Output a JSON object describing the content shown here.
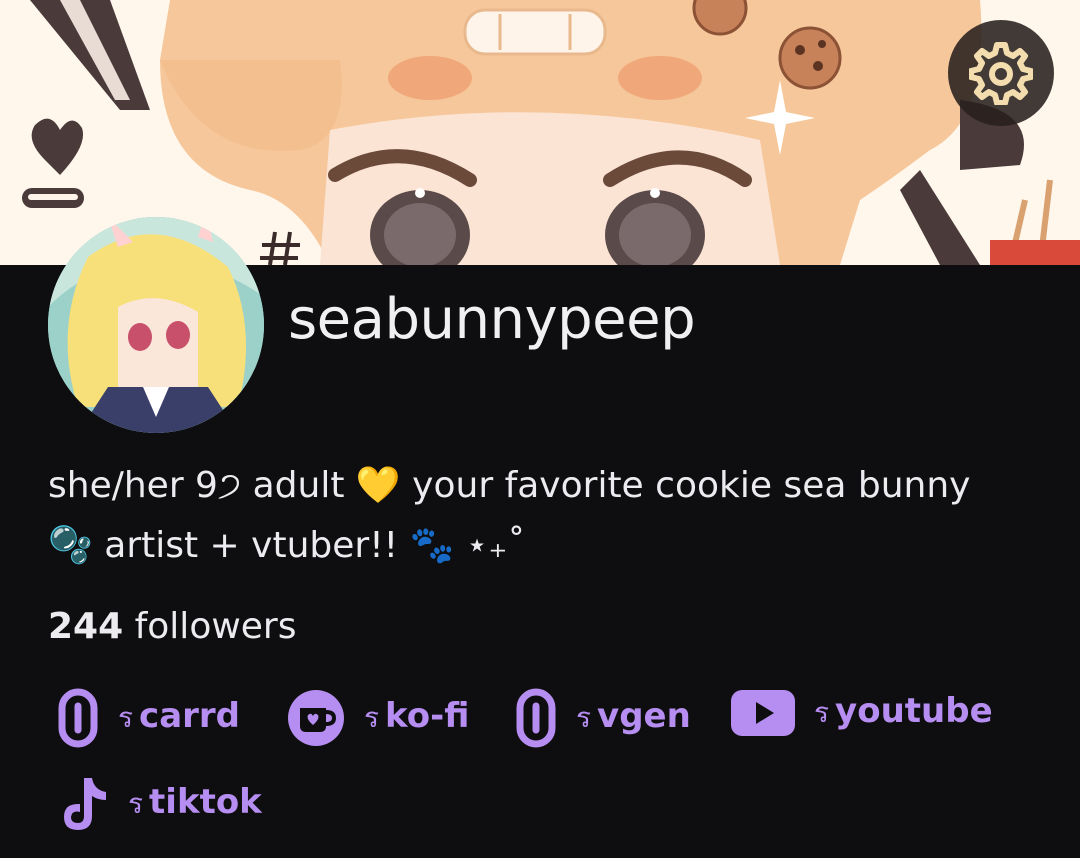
{
  "profile": {
    "username": "seabunnypeep",
    "bio": "she/her 9੭ adult 💛 your favorite cookie sea bunny 🫧 artist + vtuber!! 🐾 ⋆₊˚",
    "followers_count": "244",
    "followers_label": "followers"
  },
  "links": [
    {
      "prefix": "ร",
      "label": "carrd",
      "icon": "link-icon"
    },
    {
      "prefix": "ร",
      "label": "ko-fi",
      "icon": "kofi-cup-icon"
    },
    {
      "prefix": "ร",
      "label": "vgen",
      "icon": "link-icon"
    },
    {
      "prefix": "ร",
      "label": "youtube",
      "icon": "youtube-icon"
    },
    {
      "prefix": "ร",
      "label": "tiktok",
      "icon": "tiktok-icon"
    }
  ],
  "icons": {
    "settings": "gear-icon"
  },
  "colors": {
    "background": "#0e0e10",
    "link_accent": "#b68df0",
    "text": "#ececf0"
  }
}
